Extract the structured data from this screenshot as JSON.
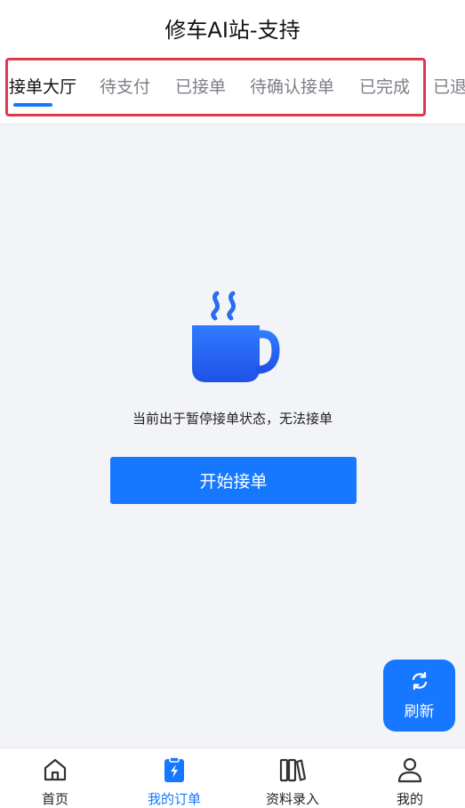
{
  "header": {
    "title": "修车AI站-支持"
  },
  "tabs": [
    {
      "label": "接单大厅",
      "active": true
    },
    {
      "label": "待支付",
      "active": false
    },
    {
      "label": "已接单",
      "active": false
    },
    {
      "label": "待确认接单",
      "active": false
    },
    {
      "label": "已完成",
      "active": false
    },
    {
      "label": "已退",
      "active": false
    }
  ],
  "empty_state": {
    "icon": "coffee-cup-icon",
    "message": "当前出于暂停接单状态，无法接单",
    "button_label": "开始接单"
  },
  "refresh": {
    "icon": "refresh-icon",
    "label": "刷新"
  },
  "bottom_nav": [
    {
      "label": "首页",
      "icon": "home-icon",
      "active": false
    },
    {
      "label": "我的订单",
      "icon": "order-clipboard-icon",
      "active": true
    },
    {
      "label": "资料录入",
      "icon": "books-icon",
      "active": false
    },
    {
      "label": "我的",
      "icon": "user-icon",
      "active": false
    }
  ],
  "colors": {
    "accent": "#1677ff",
    "highlight_border": "#e03a4a",
    "background": "#f3f4f7"
  }
}
